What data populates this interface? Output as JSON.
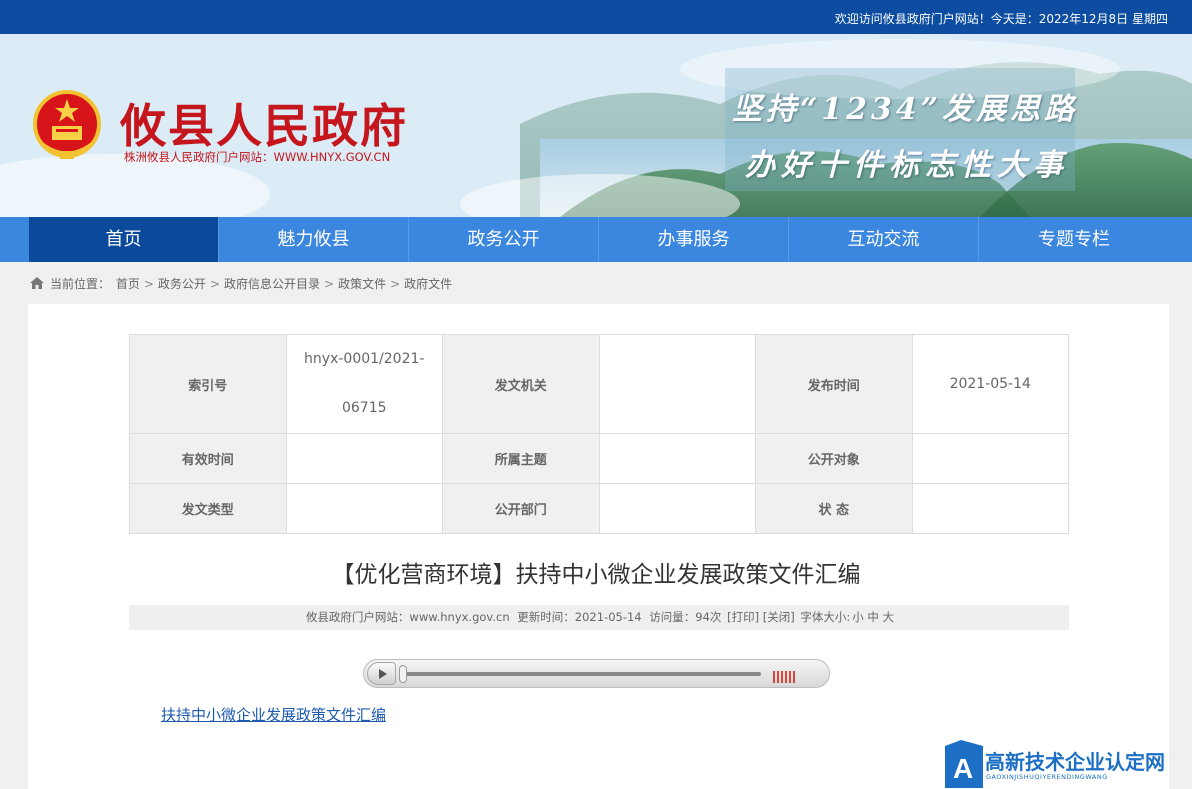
{
  "topbar": {
    "welcome": "欢迎访问攸县政府门户网站！今天是：2022年12月8日 星期四"
  },
  "header": {
    "title": "攸县人民政府",
    "subtitle": "株洲攸县人民政府门户网站：WWW.HNYX.GOV.CN",
    "slogan_line1": "坚持“1234”发展思路",
    "slogan_line2": "办好十件标志性大事"
  },
  "nav": {
    "items": [
      {
        "label": "首页"
      },
      {
        "label": "魅力攸县"
      },
      {
        "label": "政务公开"
      },
      {
        "label": "办事服务"
      },
      {
        "label": "互动交流"
      },
      {
        "label": "专题专栏"
      }
    ],
    "active_index": 0
  },
  "breadcrumb": {
    "prefix": "当前位置：",
    "items": [
      "首页",
      "政务公开",
      "政府信息公开目录",
      "政策文件",
      "政府文件"
    ],
    "separator": ">"
  },
  "meta_table": {
    "index_label": "索引号",
    "index_value_line1": "hnyx-0001/2021-",
    "index_value_line2": "06715",
    "issuer_label": "发文机关",
    "issuer_value": "",
    "publish_label": "发布时间",
    "publish_value": "2021-05-14",
    "valid_label": "有效时间",
    "valid_value": "",
    "topic_label": "所属主题",
    "topic_value": "",
    "audience_label": "公开对象",
    "audience_value": "",
    "doctype_label": "发文类型",
    "doctype_value": "",
    "dept_label": "公开部门",
    "dept_value": "",
    "status_label": "状 态",
    "status_value": ""
  },
  "article": {
    "title": "【优化营商环境】扶持中小微企业发展政策文件汇编",
    "source": "攸县政府门户网站：www.hnyx.gov.cn",
    "updated": "更新时间：2021-05-14",
    "views": "访问量：94次",
    "print": "[打印]",
    "close": "[关闭]",
    "fontsize_label": "字体大小:",
    "font_small": "小",
    "font_medium": "中",
    "font_large": "大",
    "attachment": "扶持中小微企业发展政策文件汇编"
  },
  "player": {
    "progress": 0.0
  },
  "watermark": {
    "name": "高新技术企业认定网",
    "sub": "GAOXINJISHUQIYERENDINGWANG"
  },
  "colors": {
    "topbar": "#0c4da2",
    "nav": "#3b86de",
    "nav_active": "#0b4a9a",
    "title_red": "#c4161c",
    "link": "#1e5bb0"
  }
}
